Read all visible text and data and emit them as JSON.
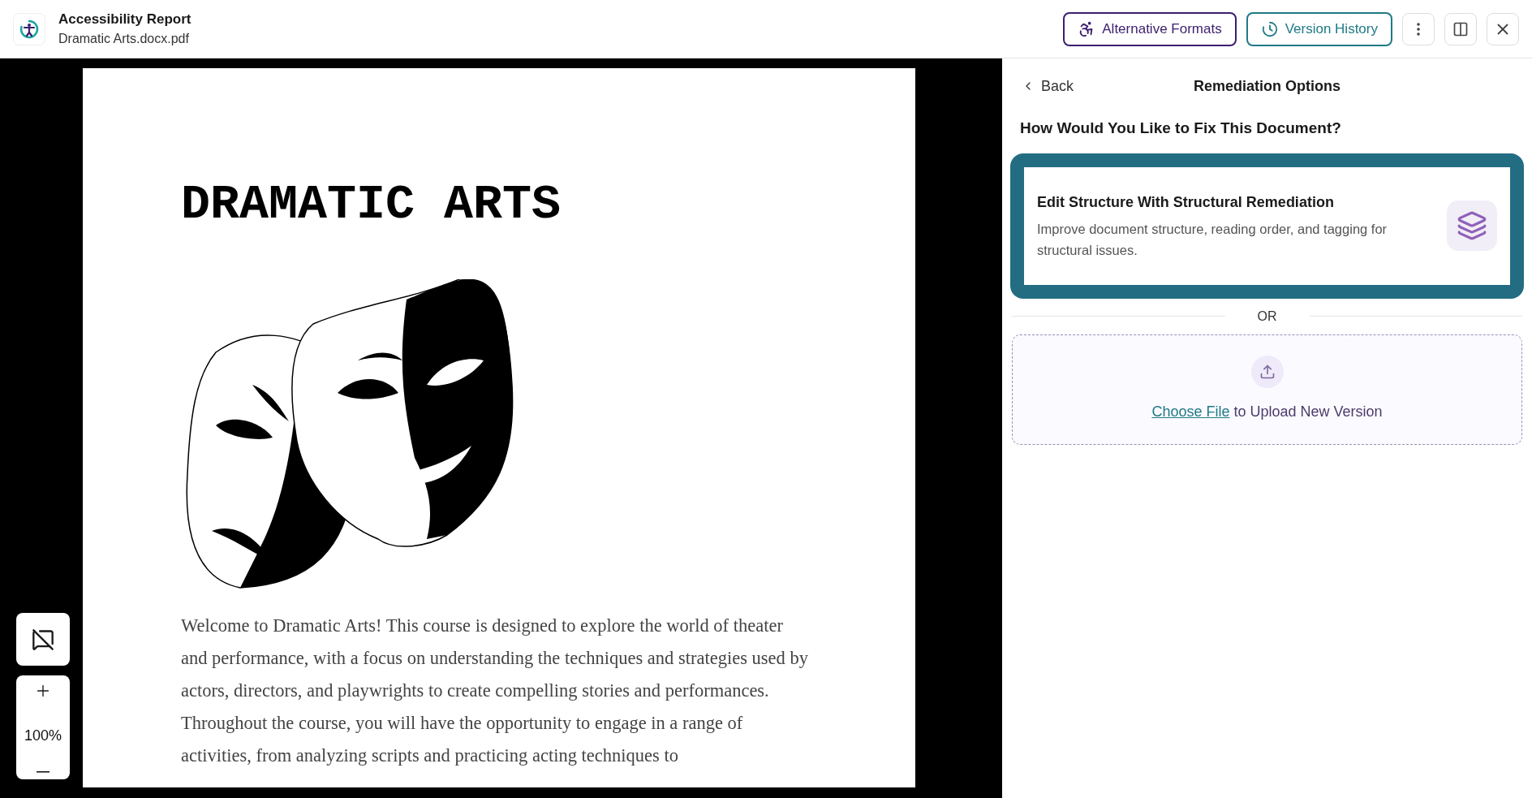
{
  "header": {
    "title": "Accessibility Report",
    "subtitle": "Dramatic Arts.docx.pdf",
    "buttons": [
      {
        "kind": "formats",
        "label": "Alternative Formats"
      },
      {
        "kind": "history",
        "label": "Version History"
      }
    ]
  },
  "document": {
    "title": "DRAMATIC ARTS",
    "paragraph": "Welcome to Dramatic Arts! This course is designed to explore the world of theater and performance, with a focus on understanding the techniques and strategies used by actors, directors, and playwrights to create compelling stories and performances. Throughout the course, you will have the opportunity to engage in a range of activities, from analyzing scripts and practicing acting techniques to"
  },
  "zoom": {
    "reading": "100%"
  },
  "panel": {
    "back": "Back",
    "title": "Remediation Options",
    "question": "How Would You Like to Fix This Document?",
    "options": [
      {
        "title": "Edit Structure With Structural Remediation",
        "description": "Improve document structure, reading order, and tagging for structural issues.",
        "selected": true
      }
    ],
    "divider": "OR",
    "upload": {
      "link": "Choose File",
      "text": "to Upload New Version"
    }
  }
}
